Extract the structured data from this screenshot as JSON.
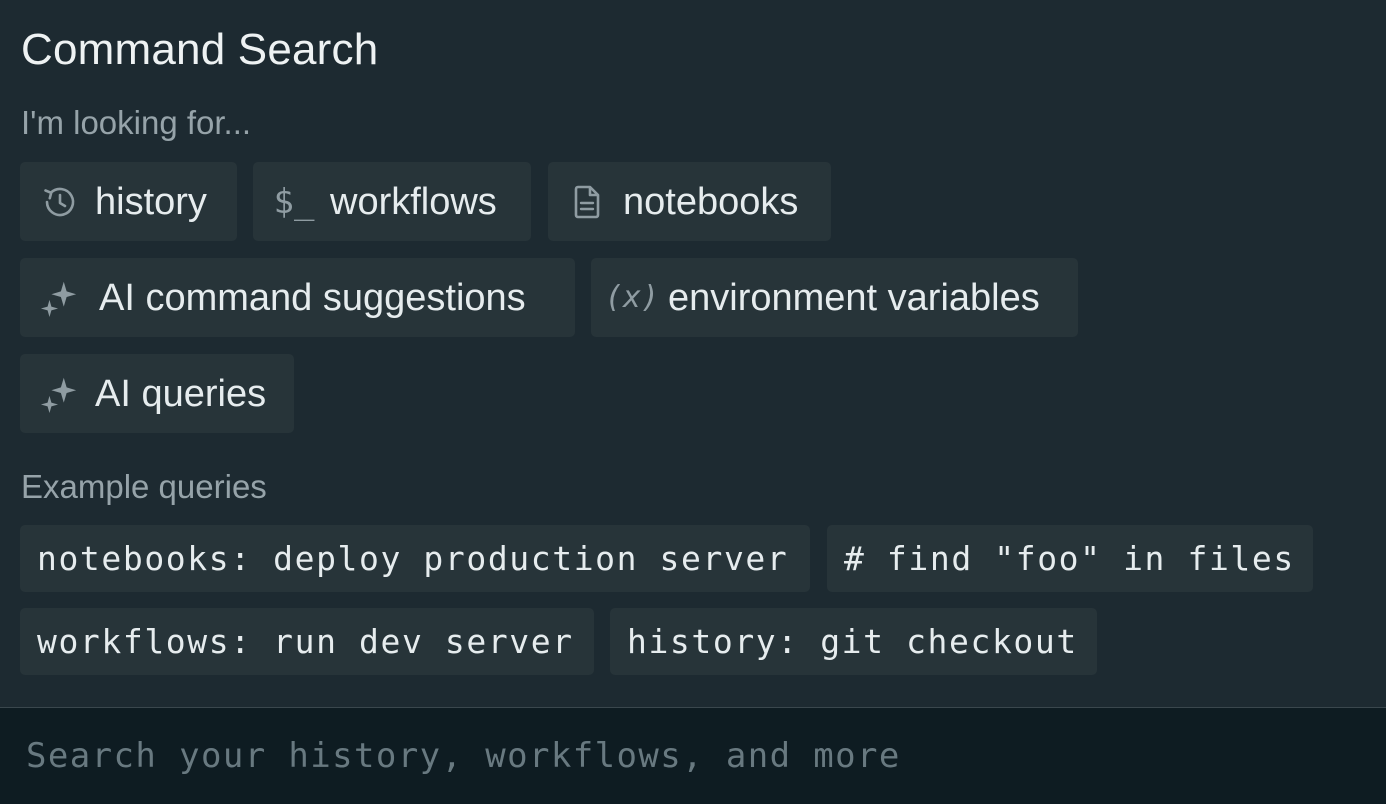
{
  "header": {
    "title": "Command Search",
    "looking_for_label": "I'm looking for..."
  },
  "filters": [
    {
      "label": "history",
      "icon": "history-icon"
    },
    {
      "label": "workflows",
      "icon": "dollar-prompt-icon",
      "glyph": "$_"
    },
    {
      "label": "notebooks",
      "icon": "document-icon"
    },
    {
      "label": "AI command suggestions",
      "icon": "sparkle-icon"
    },
    {
      "label": "environment variables",
      "icon": "variable-icon",
      "glyph": "(x)"
    },
    {
      "label": "AI queries",
      "icon": "sparkle-icon"
    }
  ],
  "examples": {
    "label": "Example queries",
    "items": [
      "notebooks: deploy production server",
      "# find \"foo\" in files",
      "workflows: run dev server",
      "history: git checkout"
    ]
  },
  "search": {
    "placeholder": "Search your history, workflows, and more",
    "value": ""
  },
  "colors": {
    "panel_bg": "#1d2a31",
    "chip_bg": "#273439",
    "search_bg": "#0e1c22",
    "text": "#e6ecee",
    "muted": "#96a3a9"
  }
}
